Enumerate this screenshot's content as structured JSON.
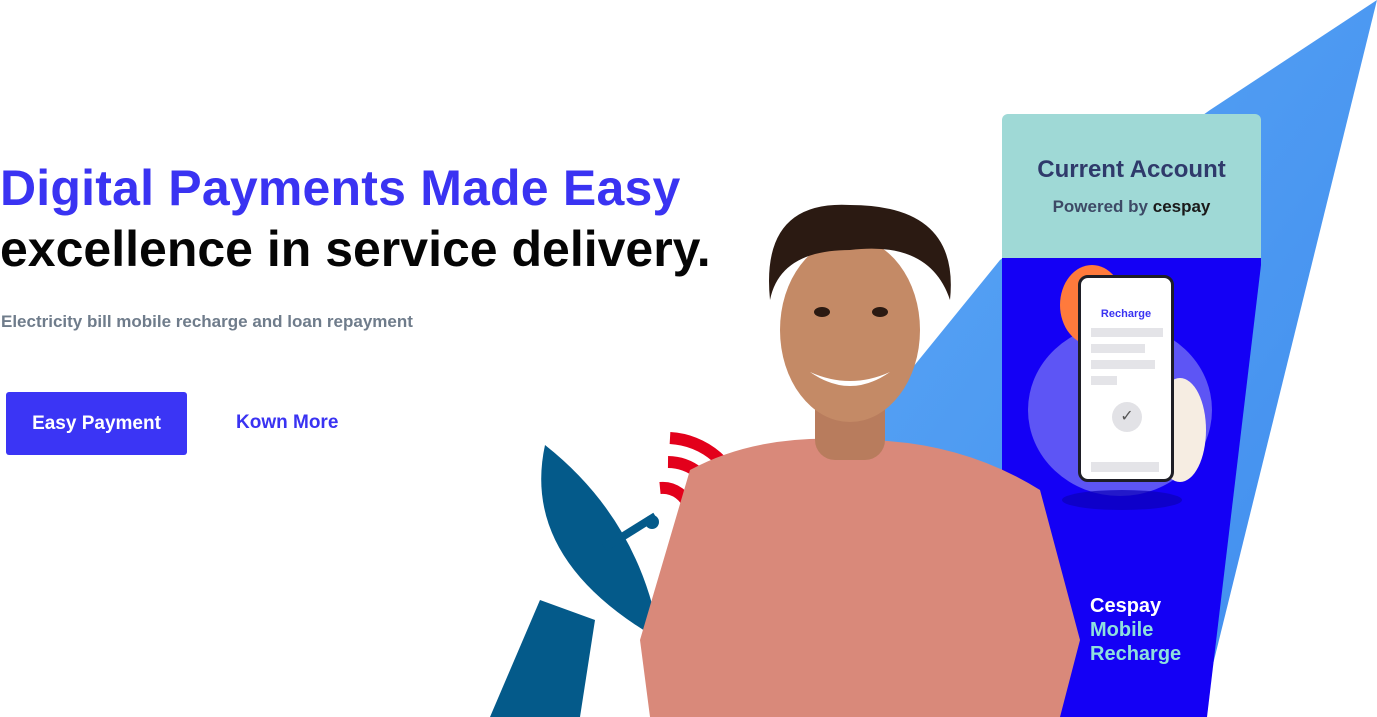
{
  "hero": {
    "headline_accent": "Digital Payments Made Easy",
    "headline_main": "excellence in service delivery.",
    "subtitle": "Electricity bill mobile recharge and  loan repayment",
    "primary_button": "Easy Payment",
    "secondary_link": "Kown More"
  },
  "card": {
    "title": "Current Account",
    "powered_prefix": "Powered by",
    "powered_brand": "cespay",
    "phone_screen_title": "Recharge",
    "product_line1": "Cespay",
    "product_line2": "Mobile",
    "product_line3": "Recharge"
  },
  "colors": {
    "accent": "#3a33f2",
    "card_blue": "#1400f5",
    "card_teal": "#9fd9d6",
    "backdrop_blue": "#4d9af2",
    "signal_red": "#e3001b",
    "dish_blue": "#045a8a"
  }
}
